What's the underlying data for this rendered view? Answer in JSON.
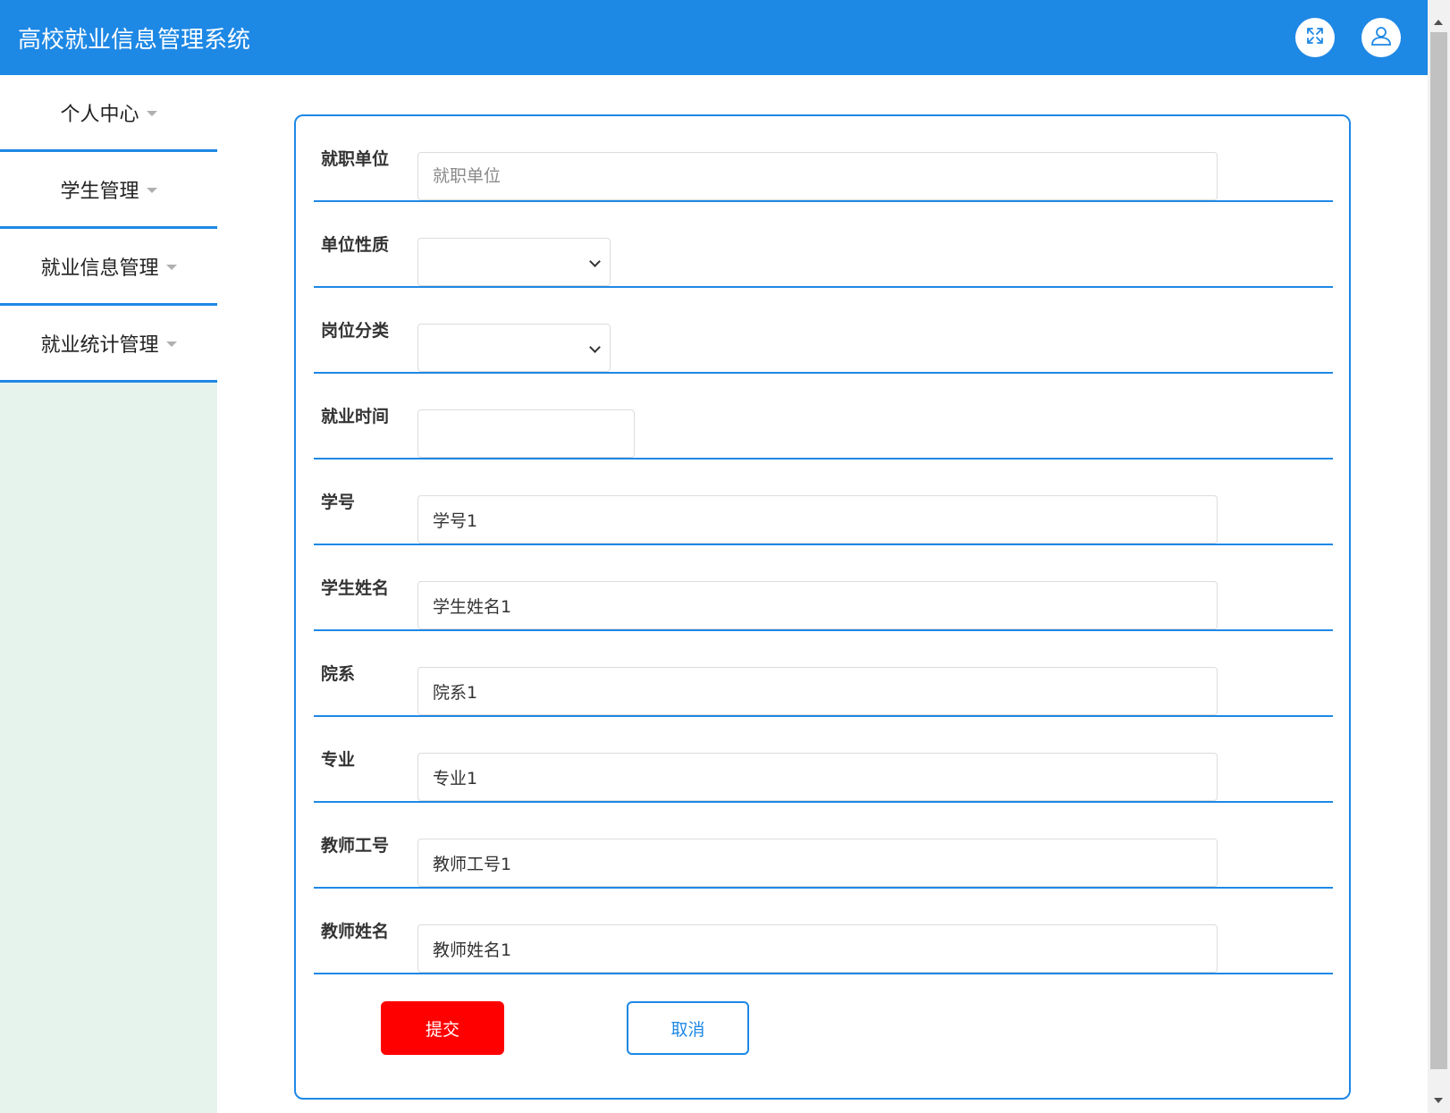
{
  "header": {
    "title": "高校就业信息管理系统",
    "fullscreen_icon": "expand-arrows-icon",
    "user_icon": "user-icon"
  },
  "sidebar": {
    "items": [
      {
        "label": "个人中心"
      },
      {
        "label": "学生管理"
      },
      {
        "label": "就业信息管理"
      },
      {
        "label": "就业统计管理"
      }
    ]
  },
  "form": {
    "employer": {
      "label": "就职单位",
      "value": "",
      "placeholder": "就职单位"
    },
    "unit_nature": {
      "label": "单位性质",
      "selected": ""
    },
    "job_category": {
      "label": "岗位分类",
      "selected": ""
    },
    "employment_time": {
      "label": "就业时间",
      "value": ""
    },
    "student_no": {
      "label": "学号",
      "value": "学号1"
    },
    "student_name": {
      "label": "学生姓名",
      "value": "学生姓名1"
    },
    "department": {
      "label": "院系",
      "value": "院系1"
    },
    "major": {
      "label": "专业",
      "value": "专业1"
    },
    "teacher_no": {
      "label": "教师工号",
      "value": "教师工号1"
    },
    "teacher_name": {
      "label": "教师姓名",
      "value": "教师姓名1"
    }
  },
  "actions": {
    "submit_label": "提交",
    "cancel_label": "取消"
  },
  "colors": {
    "primary": "#1e88e5",
    "submit": "#ff0000",
    "sidebar_bg": "#e5f3ec"
  }
}
